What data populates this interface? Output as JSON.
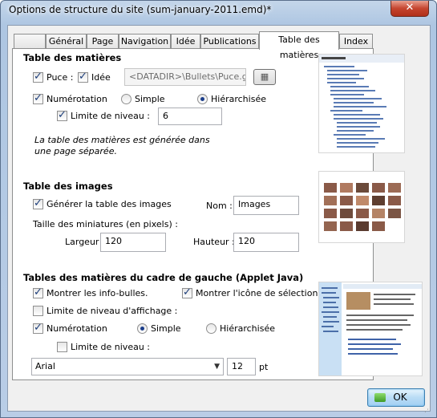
{
  "window": {
    "title": "Options de structure du site (sum-january-2011.emd)*"
  },
  "tabs": [
    "",
    "Général",
    "Page",
    "Navigation",
    "Idée",
    "Publications",
    "Table des matières",
    "Index"
  ],
  "toc": {
    "heading": "Table des matières",
    "puce_label": "Puce :",
    "idee_label": "Idée",
    "puce_path": "<DATADIR>\\Bullets\\Puce.gif",
    "numerotation_label": "Numérotation",
    "simple_label": "Simple",
    "hierarchisee_label": "Hiérarchisée",
    "limite_label": "Limite de niveau :",
    "limite_value": "6",
    "note_line1": "La table des matières est générée dans",
    "note_line2": "une page séparée."
  },
  "images": {
    "heading": "Table des images",
    "generate_label": "Générer la table des images",
    "nom_label": "Nom :",
    "nom_value": "Images",
    "miniatures_label": "Taille des miniatures (en pixels) :",
    "largeur_label": "Largeur :",
    "largeur_value": "120",
    "hauteur_label": "Hauteur :",
    "hauteur_value": "120"
  },
  "applet": {
    "heading": "Tables des matières du cadre de gauche (Applet Java)",
    "infobulles_label": "Montrer les info-bulles.",
    "icone_label": "Montrer l'icône de sélection",
    "limite_affichage_label": "Limite de niveau d'affichage :",
    "numerotation_label": "Numérotation",
    "simple_label": "Simple",
    "hierarchisee_label": "Hiérarchisée",
    "limite_label": "Limite de niveau :",
    "font_value": "Arial",
    "size_value": "12",
    "size_unit": "pt"
  },
  "buttons": {
    "ok": "OK"
  },
  "colors": {
    "accent": "#3c7fb1",
    "titlebar": "#b9cde6",
    "close": "#c5452f"
  },
  "icons": [
    "close-icon",
    "browse-icon",
    "ok-icon",
    "chevron-down-icon"
  ]
}
